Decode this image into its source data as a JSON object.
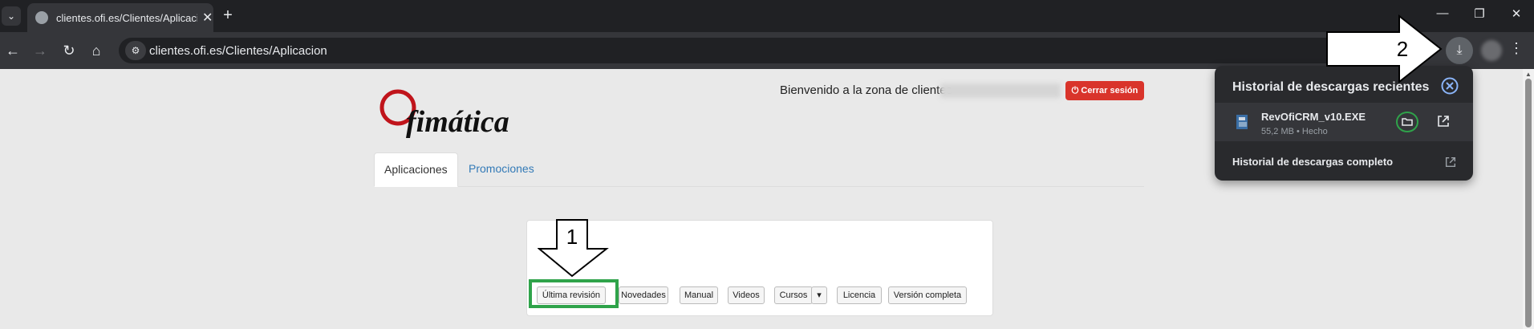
{
  "browser": {
    "tab_title": "clientes.ofi.es/Clientes/Aplicacion",
    "url": "clientes.ofi.es/Clientes/Aplicacion",
    "tab_close": "✕",
    "new_tab": "+",
    "minimize": "—",
    "restore": "❐",
    "window_close": "✕"
  },
  "header": {
    "logo_text": "fimática",
    "welcome": "Bienvenido a la zona de clientes",
    "logout_label": "Cerrar sesión"
  },
  "nav_tabs": [
    {
      "label": "Aplicaciones",
      "active": true
    },
    {
      "label": "Promociones",
      "active": false
    }
  ],
  "actions": {
    "buttons": [
      "Última revisión",
      "Novedades",
      "Manual",
      "Videos",
      "Cursos",
      "Licencia",
      "Versión completa"
    ]
  },
  "annotations": {
    "arrow1_label": "1",
    "arrow2_label": "2",
    "highlight_color": "#2fa34a"
  },
  "downloads": {
    "title": "Historial de descargas recientes",
    "file_name": "RevOfiCRM_v10.EXE",
    "file_meta": "55,2 MB • Hecho",
    "full_history": "Historial de descargas completo"
  },
  "colors": {
    "accent_red": "#d9342b",
    "link_blue": "#337ab7"
  }
}
